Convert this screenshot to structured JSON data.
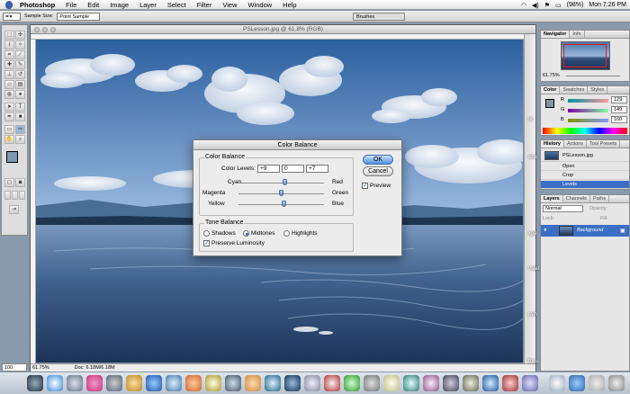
{
  "menubar": {
    "app": "Photoshop",
    "items": [
      "File",
      "Edit",
      "Image",
      "Layer",
      "Select",
      "Filter",
      "View",
      "Window",
      "Help"
    ],
    "battery": "(98%)",
    "clock": "Mon 7:26 PM"
  },
  "options": {
    "sample_size_label": "Sample Size:",
    "sample_size_value": "Point Sample",
    "brushes_label": "Brushes"
  },
  "document": {
    "title": "PSLesson.jpg @ 61.8% (RGB)",
    "zoom": "61.75%",
    "doc_info": "Doc: 6.18M/6.18M",
    "bottom_zoom": "100"
  },
  "dialog": {
    "title": "Color Balance",
    "color_balance_group": "Color Balance",
    "color_levels_label": "Color Levels:",
    "levels": [
      "+9",
      "0",
      "+7"
    ],
    "sliders": [
      {
        "left": "Cyan",
        "right": "Red",
        "value": 9
      },
      {
        "left": "Magenta",
        "right": "Green",
        "value": 0
      },
      {
        "left": "Yellow",
        "right": "Blue",
        "value": 7
      }
    ],
    "tone_balance_group": "Tone Balance",
    "tones": [
      "Shadows",
      "Midtones",
      "Highlights"
    ],
    "tone_selected": "Midtones",
    "preserve_luminosity": "Preserve Luminosity",
    "ok": "OK",
    "cancel": "Cancel",
    "preview": "Preview"
  },
  "navigator": {
    "tabs": [
      "Navigator",
      "Info"
    ],
    "zoom": "61.75%"
  },
  "color_palette": {
    "tabs": [
      "Color",
      "Swatches",
      "Styles"
    ],
    "channels": [
      {
        "label": "R",
        "value": "129"
      },
      {
        "label": "G",
        "value": "149"
      },
      {
        "label": "B",
        "value": "160"
      }
    ]
  },
  "history": {
    "tabs": [
      "History",
      "Actions",
      "Tool Presets"
    ],
    "snapshot": "PSLesson.jpg",
    "states": [
      "Open",
      "Crop",
      "Levels"
    ]
  },
  "layers": {
    "tabs": [
      "Layers",
      "Channels",
      "Paths"
    ],
    "blend_mode": "Normal",
    "opacity_label": "Opacity:",
    "lock_label": "Lock:",
    "fill_label": "Fill:",
    "layer_name": "Background"
  },
  "desktop_labels": [
    "st",
    "ebs",
    "xpe",
    "vslet",
    "rain",
    "thou"
  ]
}
